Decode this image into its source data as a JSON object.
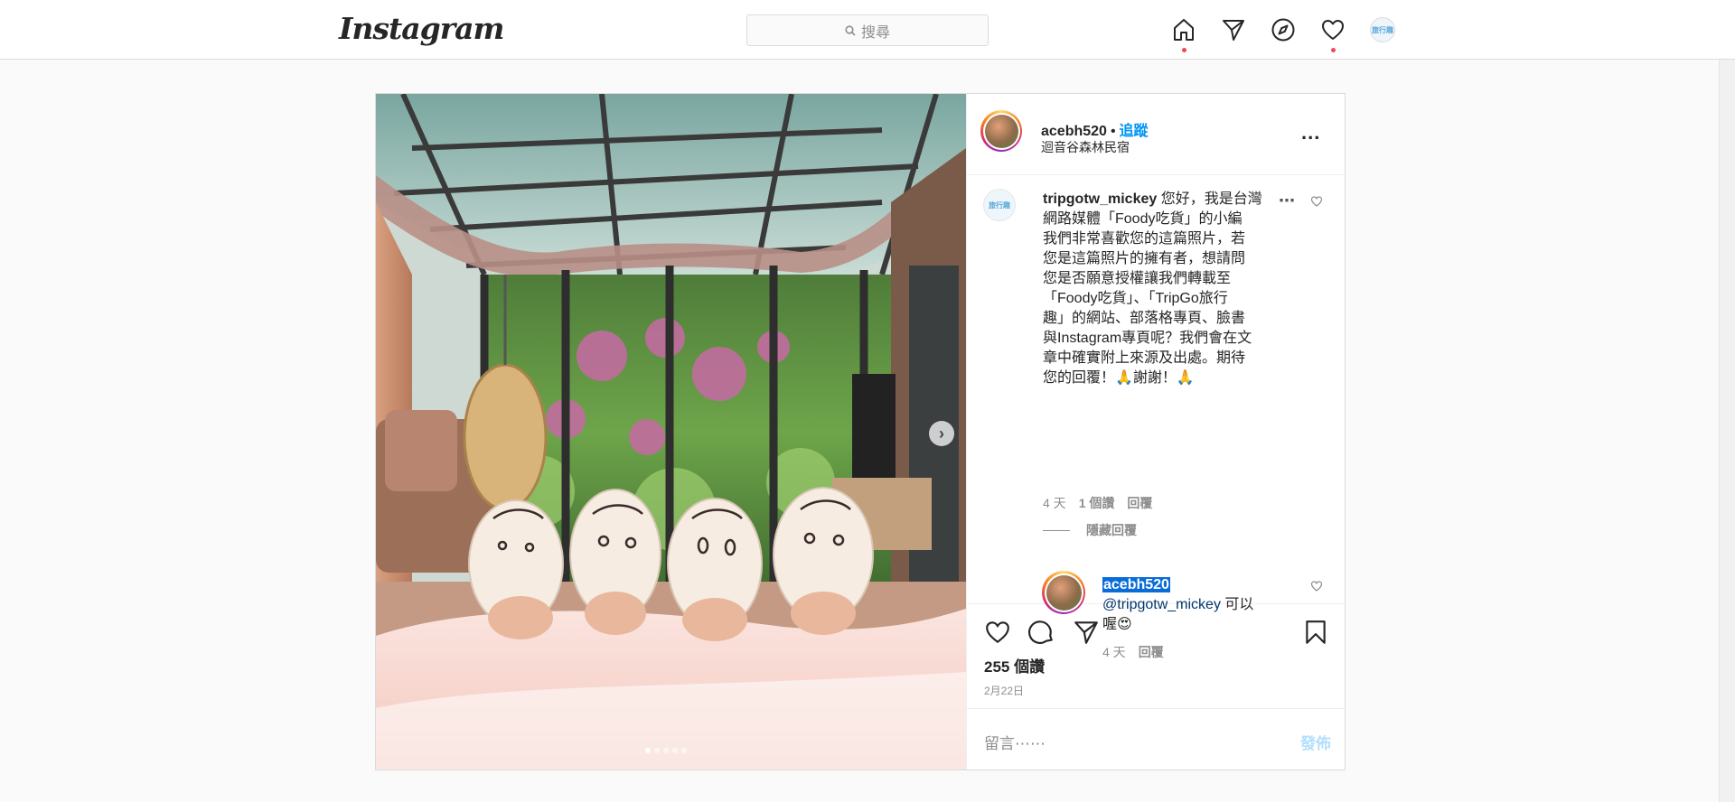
{
  "nav": {
    "logo": "Instagram",
    "search_placeholder": "搜尋",
    "icons": [
      "home-icon",
      "direct-icon",
      "explore-icon",
      "activity-heart-icon",
      "profile-avatar"
    ],
    "avatar_text": "旅行趣"
  },
  "post": {
    "owner": {
      "username": "acebh520",
      "separator": "•",
      "follow_label": "追蹤",
      "location": "迴音谷森林民宿"
    },
    "more_label": "...",
    "comments": [
      {
        "avatar_text": "旅行趣",
        "username": "tripgotw_mickey",
        "text_lines": [
          "您好，我是台灣",
          "網路媒體「Foody吃貨」的小編",
          "我們非常喜歡您的這篇照片，若",
          "您是這篇照片的擁有者，想請問",
          "您是否願意授權讓我們轉載至",
          "「Foody吃貨」、「TripGo旅行",
          "趣」的網站、部落格專頁、臉書",
          "與Instagram專頁呢？我們會在文",
          "章中確實附上來源及出處。期待",
          "您的回覆！🙏謝謝！🙏"
        ],
        "time": "4 天",
        "likes": "1 個讚",
        "reply_label": "回覆"
      }
    ],
    "hide_replies_label": "隱藏回覆",
    "reply": {
      "username": "acebh520",
      "mention": "@tripgotw_mickey",
      "text_line1": " 可以",
      "text_line2": "喔😍",
      "time": "4 天",
      "reply_label": "回覆"
    },
    "likes_count": "255 個讚",
    "date": "2月22日",
    "add_comment_placeholder": "留言⋯⋯",
    "post_button": "發佈",
    "carousel": {
      "total": 5,
      "active_index": 0
    }
  },
  "colors": {
    "link_blue": "#0095f6",
    "post_btn_disabled": "#b2dffc",
    "notification_dot": "#ed4956"
  }
}
